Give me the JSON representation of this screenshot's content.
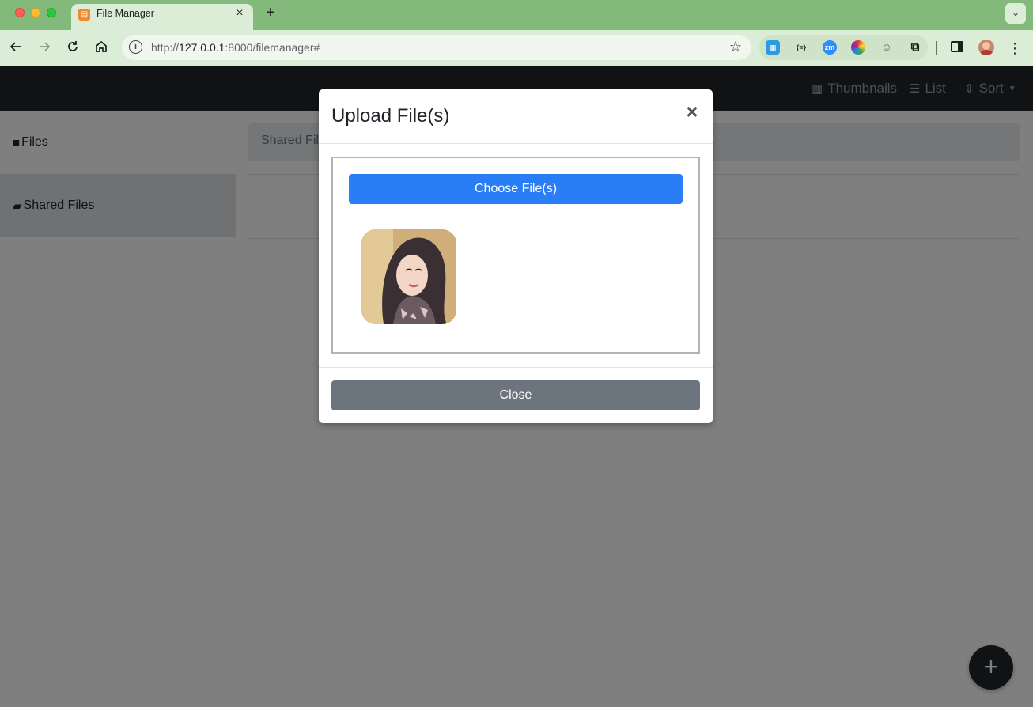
{
  "browser": {
    "tab": {
      "title": "File Manager",
      "close_glyph": "×"
    },
    "new_tab_glyph": "+",
    "url": {
      "scheme": "http://",
      "host": "127.0.0.1",
      "rest": ":8000/filemanager#"
    },
    "icons": [
      "back-icon",
      "forward-icon",
      "reload-icon",
      "home-icon",
      "site-info-icon",
      "bookmark-star-icon",
      "extensions-icon",
      "side-panel-icon",
      "profile-avatar",
      "more-menu-icon"
    ],
    "extensions": [
      {
        "name": "ext-window-icon",
        "glyph": "▦",
        "color": "#2a9de0"
      },
      {
        "name": "ext-json-icon",
        "glyph": "{≡}",
        "color": "#333333"
      },
      {
        "name": "ext-zoom-icon",
        "glyph": "zm",
        "color": "#2d8cff"
      },
      {
        "name": "ext-color-icon",
        "glyph": "◉",
        "color": "#7b3fc4"
      },
      {
        "name": "ext-face-icon",
        "glyph": "☺",
        "color": "#555555"
      }
    ]
  },
  "navbar": {
    "thumbnails_label": "Thumbnails",
    "list_label": "List",
    "sort_label": "Sort"
  },
  "sidebar": {
    "items": [
      {
        "label": "Files",
        "icon": "folder-icon",
        "active": false
      },
      {
        "label": "Shared Files",
        "icon": "folder-open-icon",
        "active": true
      }
    ]
  },
  "main": {
    "breadcrumb": "Shared Files"
  },
  "fab": {
    "glyph": "+"
  },
  "modal": {
    "title": "Upload File(s)",
    "close_glyph": "×",
    "choose_button": "Choose File(s)",
    "close_button": "Close",
    "thumbnail": "uploaded-image-thumbnail"
  },
  "colors": {
    "tabbar": "#84b97c",
    "toolbar": "#dcedd7",
    "navbar": "#212529",
    "primary": "#2a7ef5",
    "secondary": "#6c757d"
  }
}
